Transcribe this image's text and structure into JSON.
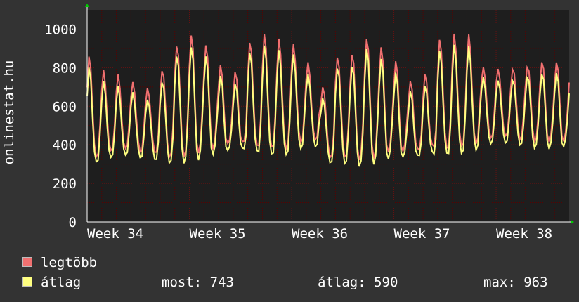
{
  "chart_data": {
    "type": "line",
    "ylabel": "onlinestat.hu",
    "ylim": [
      0,
      1100
    ],
    "yticks": [
      0,
      200,
      400,
      600,
      800,
      1000
    ],
    "xlim": [
      0,
      33
    ],
    "xticks": [
      {
        "label": "Week 34",
        "x": 0
      },
      {
        "label": "Week 35",
        "x": 7
      },
      {
        "label": "Week 36",
        "x": 14
      },
      {
        "label": "Week 37",
        "x": 21
      },
      {
        "label": "Week 38",
        "x": 28
      }
    ],
    "grid": true,
    "colors": {
      "legtobb": "#f07070",
      "atlag": "#ffff80",
      "plot_bg": "#1e1e1e",
      "grid": "#5a0000",
      "axis": "#ffffff",
      "arrow": "#00cc00"
    },
    "daily_peaks_avg": [
      780,
      710,
      700,
      690,
      660,
      740,
      860,
      900,
      860,
      770,
      730,
      880,
      900,
      870,
      860,
      780,
      670,
      820,
      810,
      890,
      840,
      780,
      690,
      710,
      880,
      900,
      900,
      760
    ],
    "daily_troughs_avg": [
      320,
      340,
      340,
      320,
      320,
      320,
      330,
      340,
      350,
      350,
      360,
      360,
      360,
      360,
      380,
      380,
      300,
      310,
      310,
      320,
      330,
      320,
      320,
      350,
      360,
      370,
      380,
      400
    ],
    "series": [
      {
        "name": "legtöbb"
      },
      {
        "name": "átlag"
      }
    ]
  },
  "legend": {
    "legtobb": "legtöbb",
    "atlag": "átlag",
    "most": "most: 743",
    "atlag_stat": "átlag: 590",
    "max": "max: 963"
  }
}
